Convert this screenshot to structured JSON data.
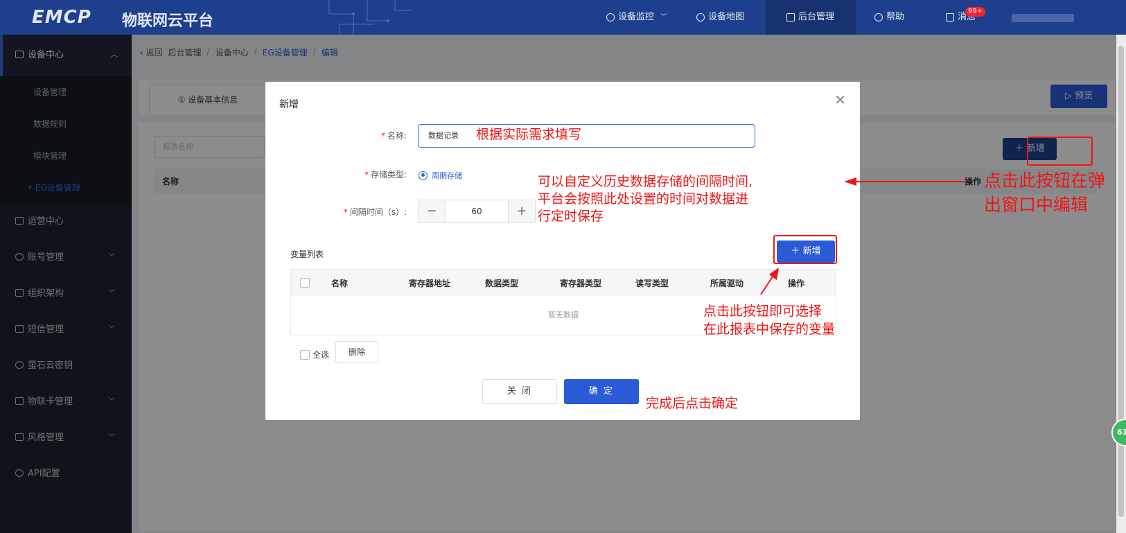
{
  "header": {
    "logo": "EMCP",
    "platform_name": "物联网云平台",
    "nav": [
      {
        "label": "设备监控",
        "icon": "location-icon"
      },
      {
        "label": "设备地图",
        "icon": "user-icon"
      },
      {
        "label": "后台管理",
        "icon": "monitor-icon"
      },
      {
        "label": "帮助",
        "icon": "help-icon"
      },
      {
        "label": "消息",
        "icon": "message-icon"
      }
    ],
    "message_badge": "99+"
  },
  "sidebar": {
    "section_title": "设备中心",
    "sub_items": [
      "设备管理",
      "数据规则",
      "模块管理",
      "• EG设备管理"
    ],
    "items": [
      "运营中心",
      "账号管理",
      "组织架构",
      "短信管理",
      "萤石云密钥",
      "物联卡管理",
      "风格管理",
      "API配置"
    ]
  },
  "breadcrumb": {
    "back": "返回",
    "items": [
      "后台管理",
      "设备中心",
      "EG设备管理",
      "编辑"
    ]
  },
  "page": {
    "tab_label": "① 设备基本信息",
    "preview_label": "预览",
    "search_placeholder": "报表名称",
    "col_name": "名称",
    "col_action": "操作",
    "add_label": "新增"
  },
  "modal": {
    "title": "新增",
    "name_label": "名称:",
    "name_value": "数据记录",
    "storage_label": "存储类型:",
    "storage_option": "周期存储",
    "interval_label": "间隔时间（s）:",
    "interval_value": "60",
    "var_list_title": "变量列表",
    "var_add_label": "新增",
    "columns": [
      "名称",
      "寄存器地址",
      "数据类型",
      "寄存器类型",
      "读写类型",
      "所属驱动",
      "操作"
    ],
    "empty_text": "暂无数据",
    "select_all": "全选",
    "delete_label": "删除",
    "close_label": "关 闭",
    "ok_label": "确 定"
  },
  "annotations": {
    "fill_hint": "根据实际需求填写",
    "interval_hint_1": "可以自定义历史数据存储的间隔时间,",
    "interval_hint_2": "平台会按照此处设置的时间对数据进",
    "interval_hint_3": "行定时保存",
    "edit_hint_1": "点击此按钮在弹",
    "edit_hint_2": "出窗口中编辑",
    "var_hint_1": "点击此按钮即可选择",
    "var_hint_2": "在此报表中保存的变量",
    "ok_hint": "完成后点击确定"
  },
  "float_badge": "61",
  "colors": {
    "header": "#1e3f8e",
    "primary": "#2a5bd7",
    "annotation": "#f01414"
  }
}
